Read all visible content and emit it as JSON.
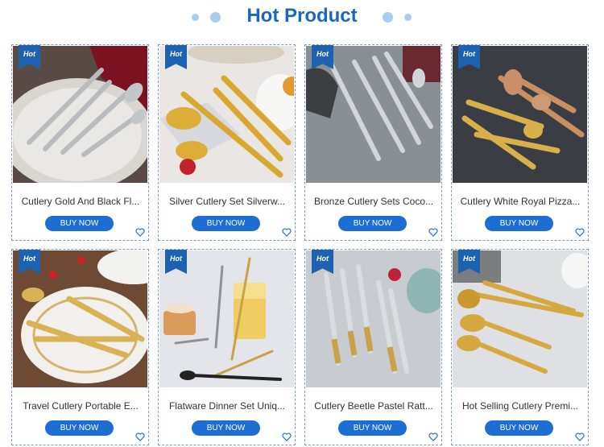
{
  "header": {
    "title": "Hot Product"
  },
  "badge": "Hot",
  "products": [
    {
      "name": "Cutlery Gold And Black Fl...",
      "button": "BUY NOW"
    },
    {
      "name": "Silver Cutlery Set Silverw...",
      "button": "BUY NOW"
    },
    {
      "name": "Bronze Cutlery Sets Coco...",
      "button": "BUY NOW"
    },
    {
      "name": "Cutlery White Royal Pizza...",
      "button": "BUY NOW"
    },
    {
      "name": "Travel Cutlery Portable E...",
      "button": "BUY NOW"
    },
    {
      "name": "Flatware Dinner Set Uniq...",
      "button": "BUY NOW"
    },
    {
      "name": "Cutlery Beetle Pastel Ratt...",
      "button": "BUY NOW"
    },
    {
      "name": "Hot Selling Cutlery Premi...",
      "button": "BUY NOW"
    }
  ],
  "colors": {
    "accent": "#1c68b8",
    "button": "#1d6ed3",
    "badge": "#1d62b0"
  },
  "icons": {
    "wishlist": "heart-outline-icon"
  }
}
